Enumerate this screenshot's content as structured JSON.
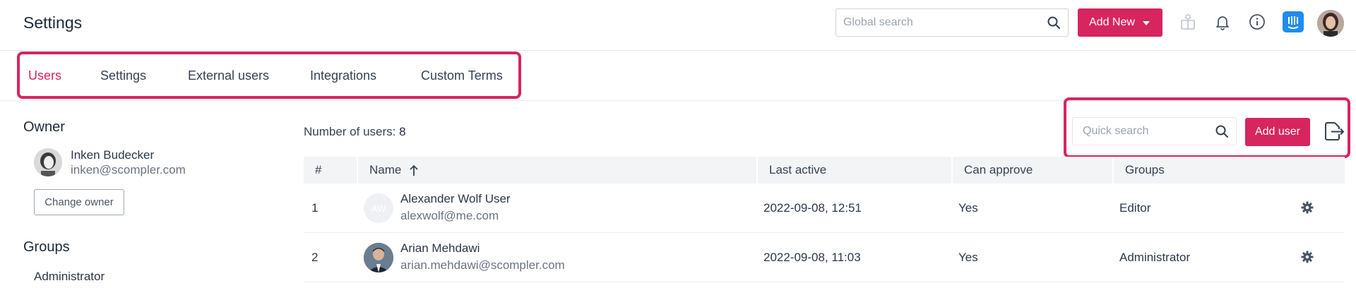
{
  "header": {
    "title": "Settings",
    "search_placeholder": "Global search",
    "add_new_label": "Add New",
    "brand_color": "#d6255f"
  },
  "tabs": [
    {
      "label": "Users",
      "active": true
    },
    {
      "label": "Settings",
      "active": false
    },
    {
      "label": "External users",
      "active": false
    },
    {
      "label": "Integrations",
      "active": false
    },
    {
      "label": "Custom Terms",
      "active": false
    }
  ],
  "owner": {
    "heading": "Owner",
    "name": "Inken Budecker",
    "email": "inken@scompler.com",
    "change_label": "Change owner"
  },
  "groups": {
    "heading": "Groups",
    "items": [
      "Administrator"
    ]
  },
  "users": {
    "count_label": "Number of users:",
    "count": "8",
    "quick_search_placeholder": "Quick search",
    "add_user_label": "Add user",
    "columns": [
      "#",
      "Name",
      "Last active",
      "Can approve",
      "Groups"
    ],
    "rows": [
      {
        "index": "1",
        "initials": "AW",
        "name": "Alexander Wolf User",
        "email": "alexwolf@me.com",
        "last_active": "2022-09-08, 12:51",
        "can_approve": "Yes",
        "group": "Editor"
      },
      {
        "index": "2",
        "initials": "",
        "name": "Arian Mehdawi",
        "email": "arian.mehdawi@scompler.com",
        "last_active": "2022-09-08, 11:03",
        "can_approve": "Yes",
        "group": "Administrator"
      }
    ]
  },
  "icons": {
    "search": "search-icon",
    "bell": "bell-icon",
    "info": "info-icon",
    "book": "book-icon",
    "intercom": "intercom-icon",
    "gear": "gear-icon",
    "export": "export-icon",
    "sort": "arrow-up-icon"
  }
}
